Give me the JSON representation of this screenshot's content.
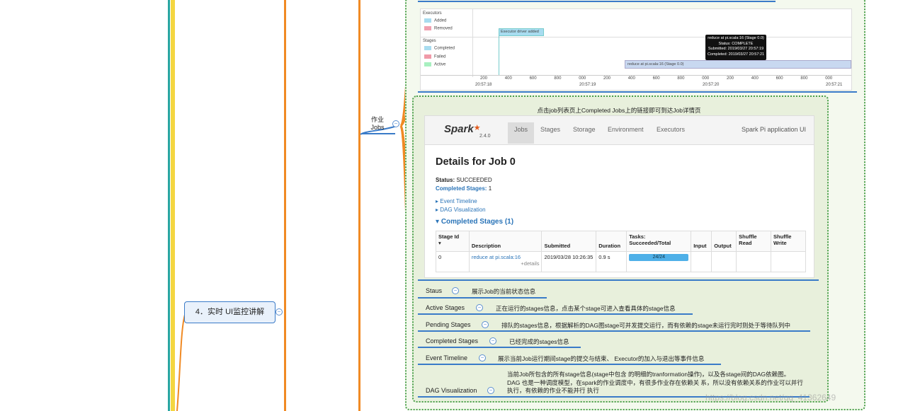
{
  "mindmap": {
    "main_node": "4．实时 UI监控讲解",
    "jobs_node": "作业\nJobs",
    "collapse_symbol": "−",
    "caption": "点击job列表页上Completed Jobs上的链接即可到达Job详情页",
    "items": [
      {
        "label": "Staus",
        "desc": "展示Job的当前状态信息"
      },
      {
        "label": "Active Stages",
        "desc": "正在运行的stages信息，点击某个stage可进入查看具体的stage信息"
      },
      {
        "label": "Pending Stages",
        "desc": "排队的stages信息，根据解析的DAG图stage可并发提交运行，而有依赖的stage未运行完时则处于等待队列中"
      },
      {
        "label": "Completed Stages",
        "desc": "已经完成的stages信息"
      },
      {
        "label": "Event Timeline",
        "desc": "展示当前Job运行期间stage的提交与结束、 Executor的加入与退出等事件信息"
      },
      {
        "label": "DAG Visualization",
        "desc": "当前Job所包含的所有stage信息(stage中包含 的明细的tranformation操作)，以及各stage间的DAG依赖图。\nDAG 也是一种调度模型，在spark的作业调度中，有很多作业存在依赖关 系，所以没有依赖关系的作业可以并行\n执行，有依赖的作业不能并行 执行"
      }
    ],
    "watermark": "https://blog.csdn.net/qq_41362649"
  },
  "timeline": {
    "executors_title": "Executors",
    "added": "Added",
    "removed": "Removed",
    "stages_title": "Stages",
    "completed": "Completed",
    "failed": "Failed",
    "active": "Active",
    "driver_added": "Executor driver added",
    "stage_bar": "reduce at pi.scala:16 (Stage 0.0)",
    "tooltip": [
      "reduce at pi.scala:16 (Stage 0.0)",
      "Status: COMPLETE",
      "Submitted: 2019/03/27 20:57:19",
      "Completed: 2019/03/27 20:57:21"
    ],
    "ticks": [
      "200",
      "400",
      "600",
      "800",
      "000",
      "200",
      "400",
      "600",
      "800",
      "000",
      "200",
      "400",
      "600",
      "800",
      "000"
    ],
    "tick_times": [
      "20:57:18",
      "20:57:19",
      "20:57:20",
      "20:57:21"
    ],
    "colors": {
      "added": "#a8dcf0",
      "removed": "#f0a0b0",
      "completed": "#a8dcf0",
      "failed": "#f09aa8",
      "active": "#a8f0c0"
    }
  },
  "spark_ui": {
    "logo": "Spark",
    "version": "2.4.0",
    "tabs": [
      "Jobs",
      "Stages",
      "Storage",
      "Environment",
      "Executors"
    ],
    "app_title": "Spark Pi application UI",
    "heading": "Details for Job 0",
    "status_label": "Status:",
    "status_value": "SUCCEEDED",
    "completed_label": "Completed Stages:",
    "completed_value": "1",
    "event_timeline": "Event Timeline",
    "dag_visualization": "DAG Visualization",
    "section_title": "Completed Stages (1)",
    "columns": [
      "Stage Id",
      "Description",
      "Submitted",
      "Duration",
      "Tasks: Succeeded/Total",
      "Input",
      "Output",
      "Shuffle Read",
      "Shuffle Write"
    ],
    "row": {
      "stage_id": "0",
      "description": "reduce at pi.scala:16",
      "details": "+details",
      "submitted": "2019/03/28 10:26:35",
      "duration": "0.9 s",
      "tasks": "24/24",
      "tasks_fraction": 1.0
    }
  }
}
